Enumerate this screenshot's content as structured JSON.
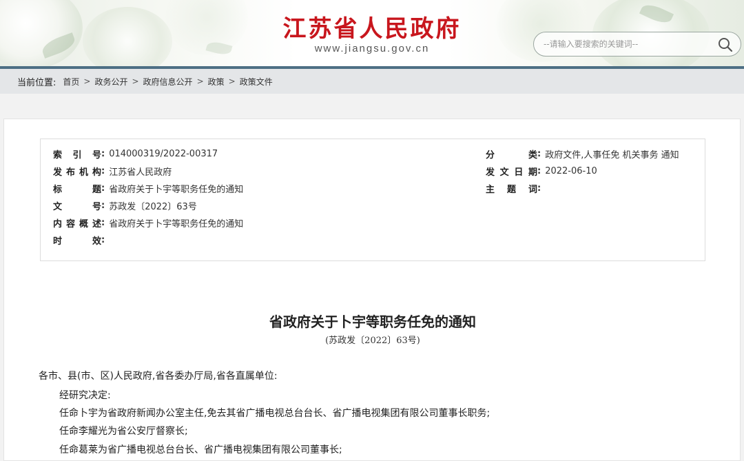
{
  "header": {
    "site_title": "江苏省人民政府",
    "site_url": "www.jiangsu.gov.cn",
    "search_placeholder": "--请输入要搜索的关键词--"
  },
  "breadcrumb": {
    "label": "当前位置:",
    "items": [
      "首页",
      "政务公开",
      "政府信息公开",
      "政策",
      "政策文件"
    ],
    "separator": ">"
  },
  "meta": {
    "left": [
      {
        "key": "索引号",
        "value": "014000319/2022-00317"
      },
      {
        "key": "发布机构",
        "value": "江苏省人民政府"
      },
      {
        "key": "标题",
        "value": "省政府关于卜宇等职务任免的通知"
      },
      {
        "key": "文号",
        "value": "苏政发〔2022〕63号"
      },
      {
        "key": "内容概述",
        "value": "省政府关于卜宇等职务任免的通知"
      },
      {
        "key": "时效",
        "value": ""
      }
    ],
    "right": [
      {
        "key": "分类",
        "value": "政府文件,人事任免 机关事务 通知"
      },
      {
        "key": "发文日期",
        "value": "2022-06-10"
      },
      {
        "key": "主题词",
        "value": ""
      }
    ],
    "colon": ":"
  },
  "document": {
    "title": "省政府关于卜宇等职务任免的通知",
    "number": "(苏政发〔2022〕63号)",
    "salutation": "各市、县(市、区)人民政府,省各委办厅局,省各直属单位:",
    "paragraphs": [
      "经研究决定:",
      "任命卜宇为省政府新闻办公室主任,免去其省广播电视总台台长、省广播电视集团有限公司董事长职务;",
      "任命李耀光为省公安厅督察长;",
      "任命葛莱为省广播电视总台台长、省广播电视集团有限公司董事长;"
    ]
  },
  "colors": {
    "title_red": "#c8161d",
    "nav_bar": "#4d6f84",
    "breadcrumb_bg": "#e4e6e8"
  }
}
